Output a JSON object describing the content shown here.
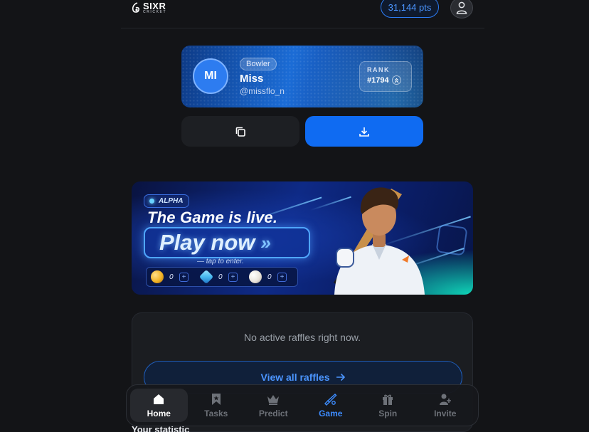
{
  "header": {
    "logo_main": "SIXR",
    "logo_sub": "CRICKET",
    "points": "31,144 pts",
    "profile_icon": "user-icon"
  },
  "profile": {
    "initials": "MI",
    "role": "Bowler",
    "name": "Miss",
    "handle": "@missflo_n",
    "rank_label": "RANK",
    "rank_value": "#1794"
  },
  "actions": {
    "copy_icon": "copy-icon",
    "download_icon": "download-icon"
  },
  "banner": {
    "badge": "ALPHA",
    "headline": "The Game is live.",
    "cta": "Play now",
    "cta_arrows": "»",
    "subtext": "— tap to enter.",
    "resources": [
      {
        "icon": "coin-icon",
        "value": "0",
        "color": "#f2b325"
      },
      {
        "icon": "gem-icon",
        "value": "0",
        "color": "#48b8f0"
      },
      {
        "icon": "ball-icon",
        "value": "0",
        "color": "#e9e4dc"
      }
    ],
    "plus": "+"
  },
  "raffles": {
    "empty_text": "No active raffles right now.",
    "view_all": "View all raffles"
  },
  "statistic_title": "Your statistic",
  "nav": {
    "items": [
      {
        "label": "Home",
        "icon": "home-icon"
      },
      {
        "label": "Tasks",
        "icon": "bookmark-icon"
      },
      {
        "label": "Predict",
        "icon": "crown-icon"
      },
      {
        "label": "Game",
        "icon": "cricket-bat-icon"
      },
      {
        "label": "Spin",
        "icon": "gift-icon"
      },
      {
        "label": "Invite",
        "icon": "add-user-icon"
      }
    ],
    "active": "Home"
  },
  "colors": {
    "accent": "#0f6bf2",
    "background": "#131417"
  }
}
